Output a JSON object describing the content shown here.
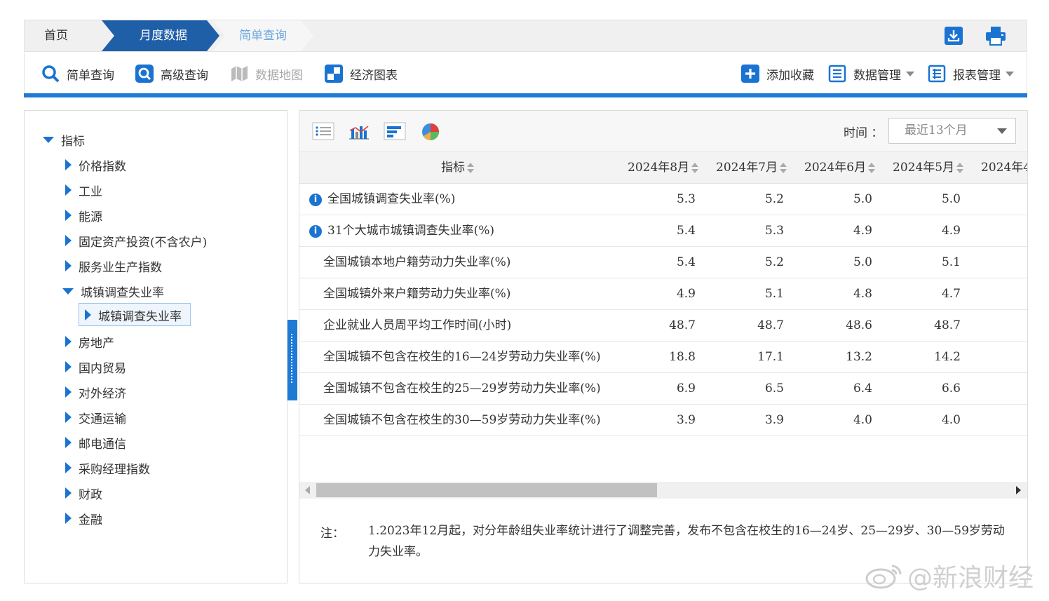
{
  "breadcrumb": {
    "home": "首页",
    "active": "月度数据",
    "next": "简单查询"
  },
  "toolbar": {
    "simple_query": "简单查询",
    "advanced_query": "高级查询",
    "data_map": "数据地图",
    "econ_chart": "经济图表",
    "add_favorite": "添加收藏",
    "data_manage": "数据管理",
    "report_manage": "报表管理"
  },
  "tree": {
    "root": "指标",
    "items": [
      "价格指数",
      "工业",
      "能源",
      "固定资产投资(不含农户)",
      "服务业生产指数",
      "城镇调查失业率",
      "房地产",
      "国内贸易",
      "对外经济",
      "交通运输",
      "邮电通信",
      "采购经理指数",
      "财政",
      "金融"
    ],
    "selected_child": "城镇调查失业率"
  },
  "time": {
    "label": "时间 ：",
    "selected": "最近13个月"
  },
  "table": {
    "header_indicator": "指标",
    "columns": [
      "2024年8月",
      "2024年7月",
      "2024年6月",
      "2024年5月",
      "2024年4"
    ],
    "rows": [
      {
        "name": "全国城镇调查失业率(%)",
        "info": true,
        "values": [
          "5.3",
          "5.2",
          "5.0",
          "5.0",
          ""
        ]
      },
      {
        "name": "31个大城市城镇调查失业率(%)",
        "info": true,
        "values": [
          "5.4",
          "5.3",
          "4.9",
          "4.9",
          ""
        ]
      },
      {
        "name": "全国城镇本地户籍劳动力失业率(%)",
        "info": false,
        "values": [
          "5.4",
          "5.2",
          "5.0",
          "5.1",
          ""
        ]
      },
      {
        "name": "全国城镇外来户籍劳动力失业率(%)",
        "info": false,
        "values": [
          "4.9",
          "5.1",
          "4.8",
          "4.7",
          ""
        ]
      },
      {
        "name": "企业就业人员周平均工作时间(小时)",
        "info": false,
        "values": [
          "48.7",
          "48.7",
          "48.6",
          "48.7",
          "4"
        ]
      },
      {
        "name": "全国城镇不包含在校生的16—24岁劳动力失业率(%)",
        "info": false,
        "values": [
          "18.8",
          "17.1",
          "13.2",
          "14.2",
          "1"
        ]
      },
      {
        "name": "全国城镇不包含在校生的25—29岁劳动力失业率(%)",
        "info": false,
        "values": [
          "6.9",
          "6.5",
          "6.4",
          "6.6",
          ""
        ]
      },
      {
        "name": "全国城镇不包含在校生的30—59岁劳动力失业率(%)",
        "info": false,
        "values": [
          "3.9",
          "3.9",
          "4.0",
          "4.0",
          ""
        ]
      }
    ]
  },
  "note": {
    "label": "注：",
    "text": "1.2023年12月起，对分年龄组失业率统计进行了调整完善，发布不包含在校生的16—24岁、25—29岁、30—59岁劳动力失业率。"
  },
  "watermark": {
    "text": "@新浪财经"
  },
  "colors": {
    "accent": "#1f7ad6",
    "crumb_active": "#1f5fa8",
    "icon_blue": "#1a73d1"
  }
}
